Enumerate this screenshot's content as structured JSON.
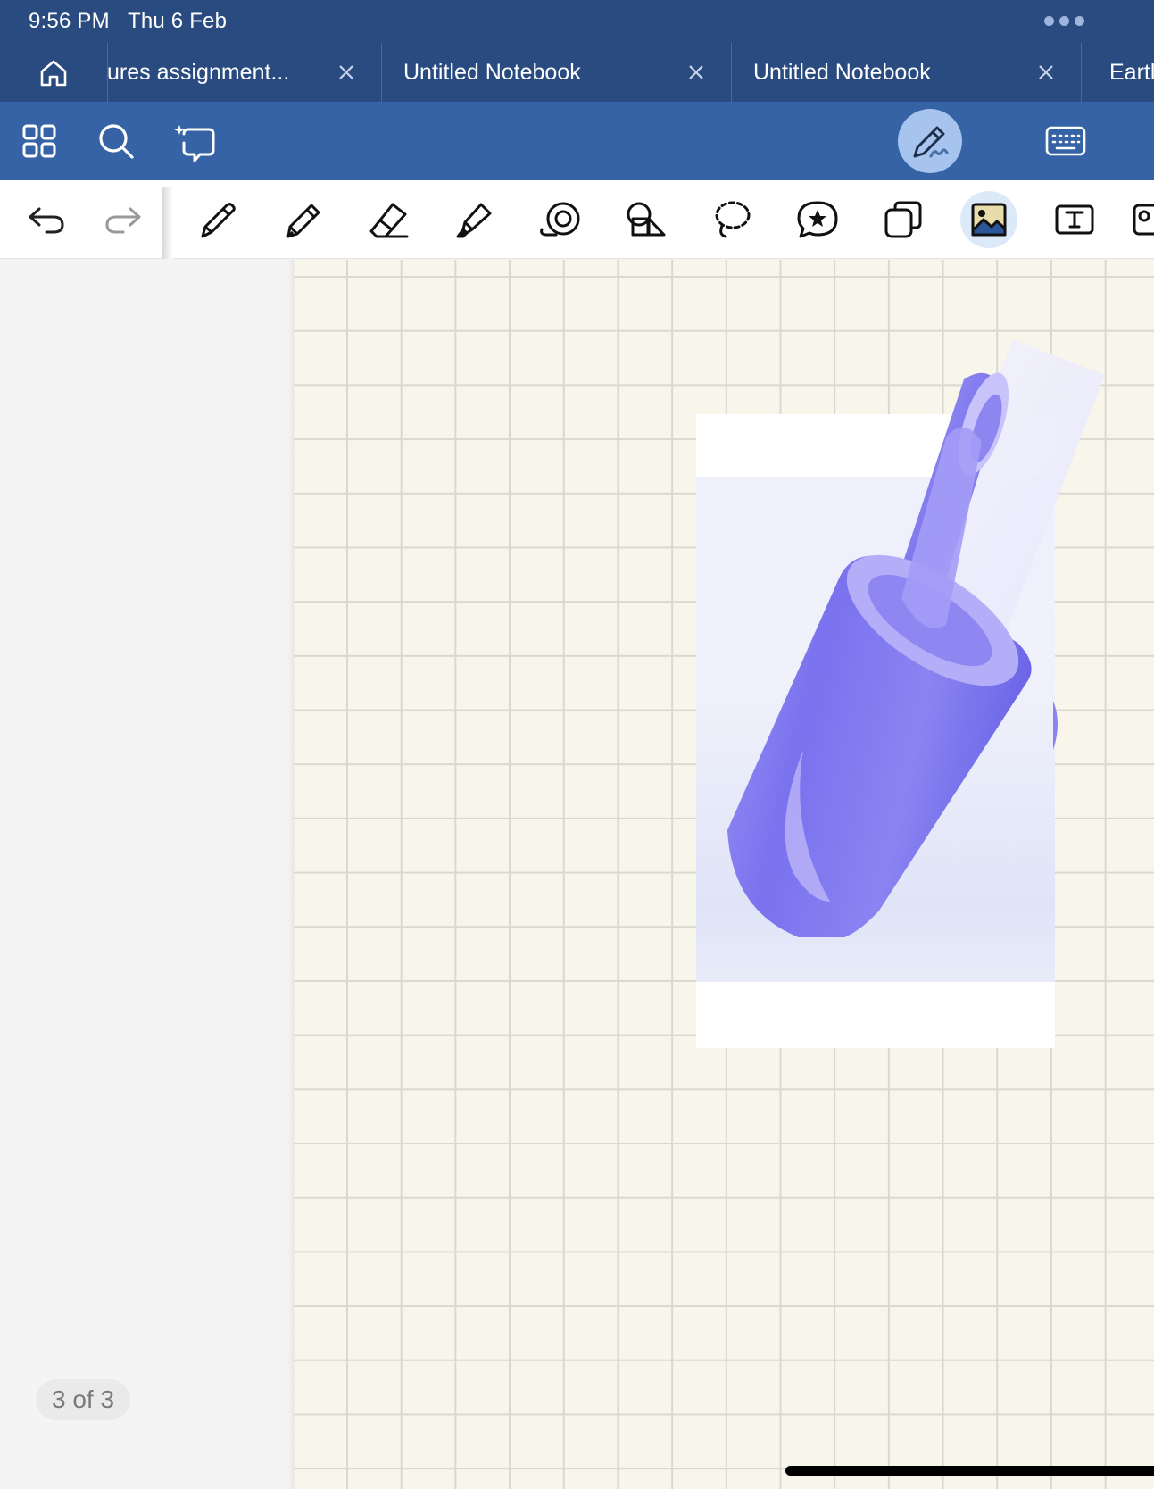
{
  "status_bar": {
    "time": "9:56 PM",
    "date": "Thu 6 Feb"
  },
  "tabs": [
    {
      "label": "ures assignment...",
      "active": false
    },
    {
      "label": "Untitled Notebook",
      "active": false
    },
    {
      "label": "Untitled Notebook",
      "active": false
    },
    {
      "label": "Eartl",
      "active": false
    }
  ],
  "toolbar": {
    "left_icons": [
      "grid-icon",
      "search-icon",
      "ai-assistant-icon"
    ],
    "right_icons": [
      "pen-mode-icon",
      "keyboard-icon"
    ]
  },
  "tools": [
    "undo-icon",
    "redo-icon",
    "pen-icon",
    "pencil-icon",
    "eraser-icon",
    "highlighter-icon",
    "laser-pointer-icon",
    "shapes-icon",
    "lasso-icon",
    "sticker-icon",
    "copy-icon",
    "image-icon",
    "text-box-icon",
    "more-tools-icon"
  ],
  "active_tool": "image-icon",
  "page_counter": "3 of 3",
  "colors": {
    "status_bg": "#294b80",
    "toolbar_bg": "#3563a5",
    "pen_mode_bg": "#a7c4ee",
    "paper": "#f8f6ea",
    "cylinder": "#7a72ee"
  }
}
